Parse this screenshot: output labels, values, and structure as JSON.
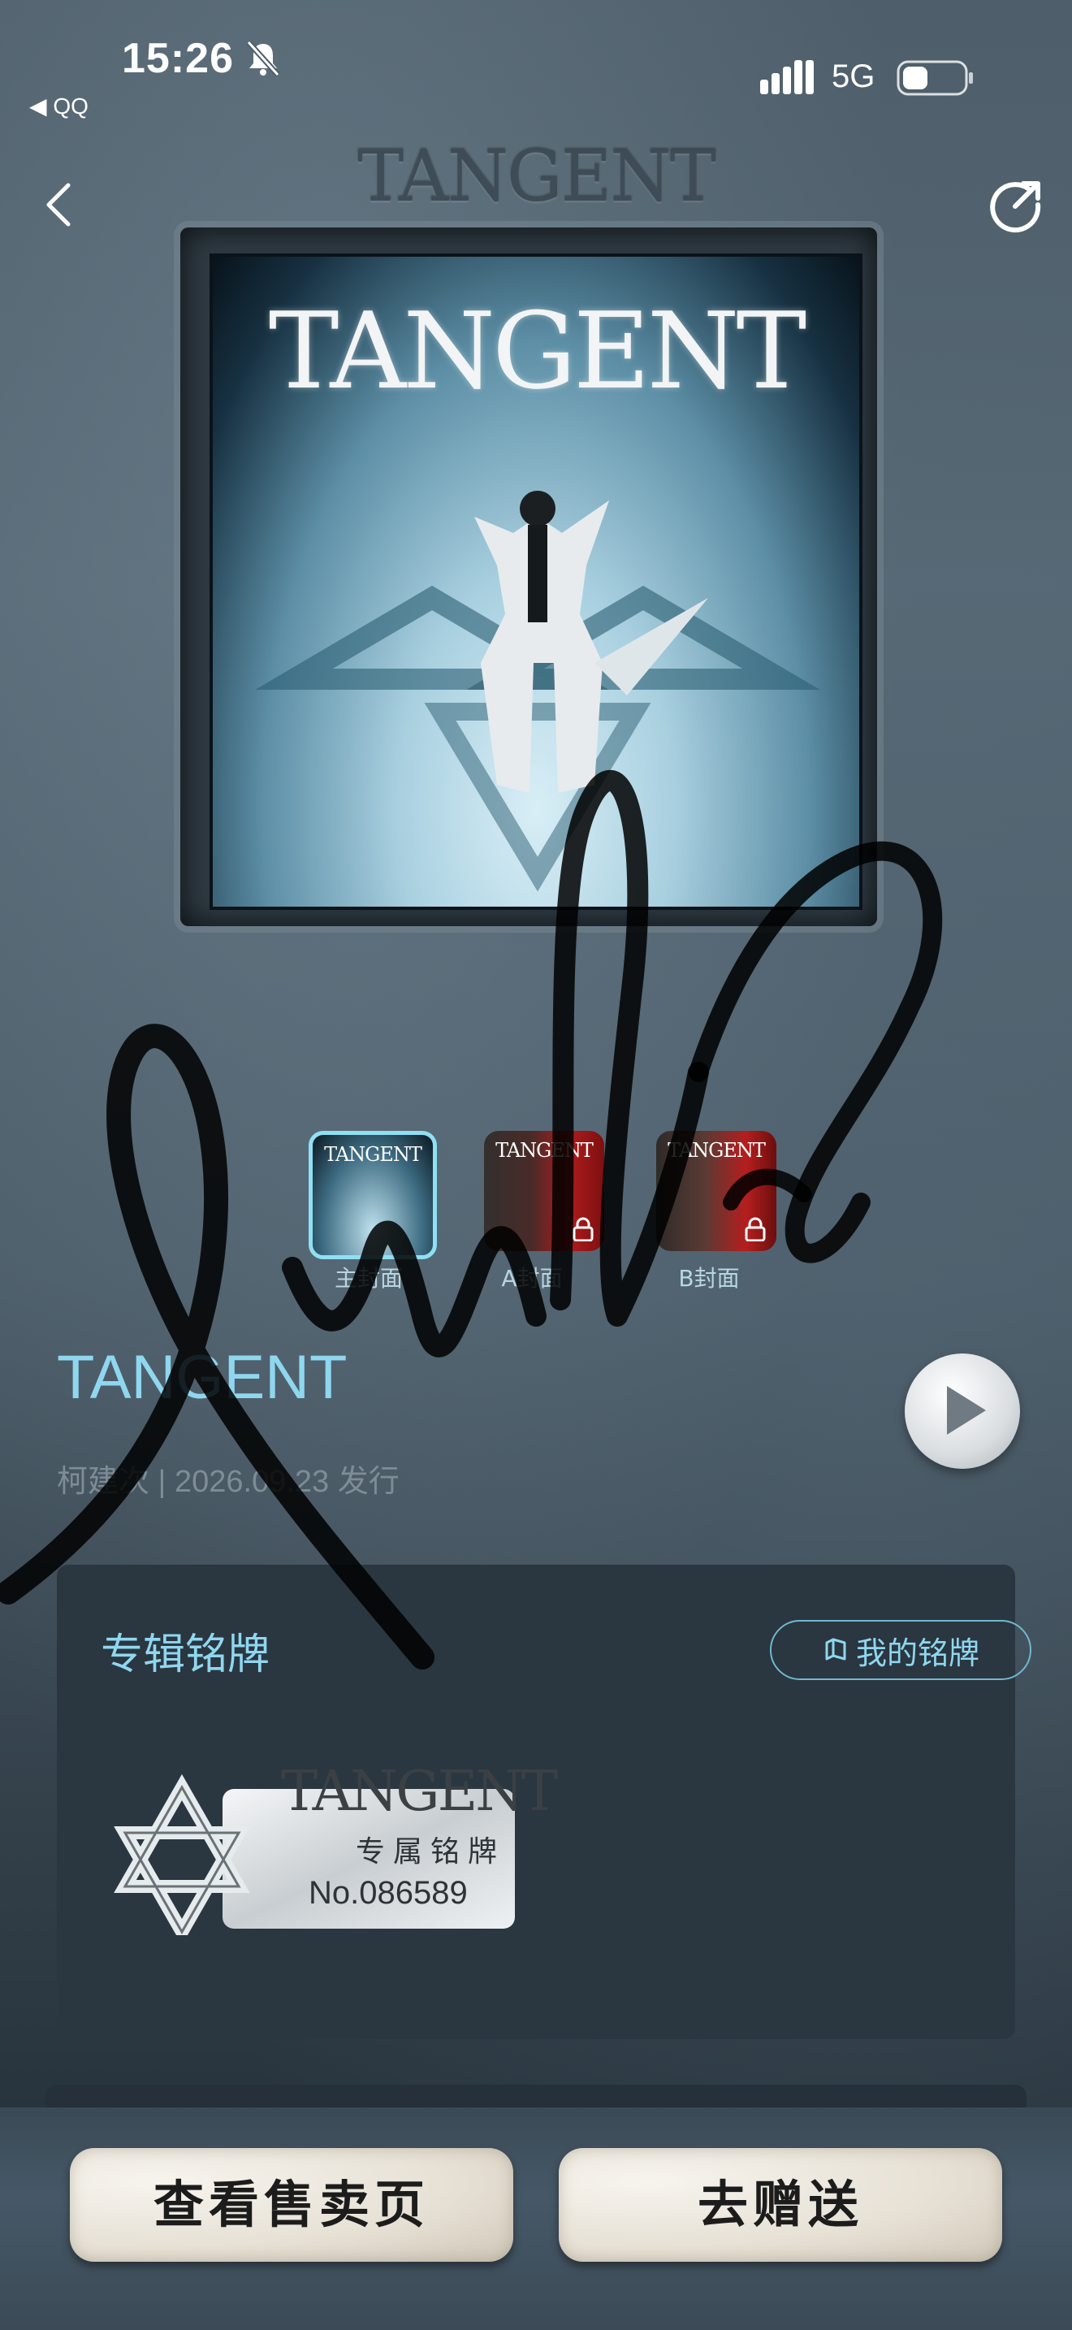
{
  "status_bar": {
    "time": "15:26",
    "back_app": "◀ QQ",
    "network": "5G"
  },
  "header": {
    "title": "TANGENT"
  },
  "cover": {
    "title": "TANGENT"
  },
  "cover_options": [
    {
      "label": "主封面",
      "thumb_text": "TANGENT",
      "selected": true
    },
    {
      "label": "A封面",
      "thumb_text": "TANGENT",
      "locked": true
    },
    {
      "label": "B封面",
      "thumb_text": "TANGENT",
      "locked": true
    }
  ],
  "album": {
    "title": "TANGENT",
    "meta": "柯建次 | 2026.09.23 发行"
  },
  "nameplate": {
    "heading": "专辑铭牌",
    "my_plate_label": "我的铭牌",
    "badge_title": "TANGENT",
    "badge_subtitle": "专属铭牌",
    "badge_number": "No.086589"
  },
  "actions": {
    "view_sale": "查看售卖页",
    "gift": "去赠送"
  },
  "colors": {
    "accent": "#8fd7ef",
    "card_bg": "#2a3640"
  }
}
